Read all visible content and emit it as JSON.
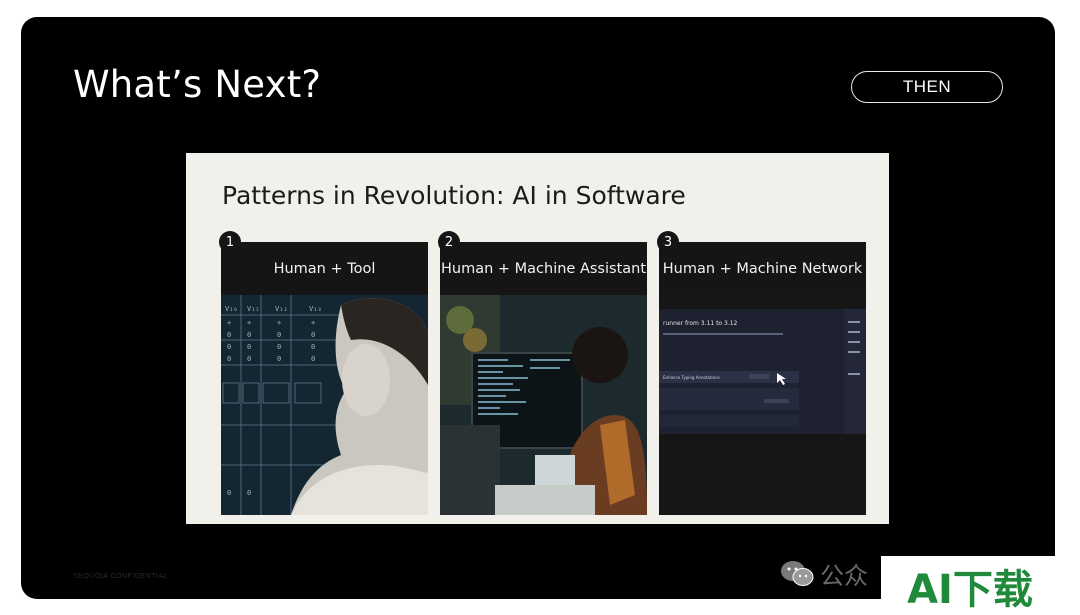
{
  "slide": {
    "title": "What’s Next?",
    "tag": "THEN",
    "footer": "SEQUOIA CONFIDENTIAL"
  },
  "inner": {
    "title": "Patterns in Revolution: AI in Software",
    "cards": [
      {
        "number": "1",
        "label": "Human + Tool"
      },
      {
        "number": "2",
        "label": "Human + Machine Assistant"
      },
      {
        "number": "3",
        "label": "Human + Machine Network"
      }
    ],
    "card3_screen": {
      "heading": "runner from 3.11 to 3.12",
      "row": "Enhance Typing Annotations"
    }
  },
  "overlay": {
    "wechat_text": "公众",
    "watermark": "AI下载"
  },
  "colors": {
    "slide_bg": "#000000",
    "panel_bg": "#f1f0ea",
    "card_bg": "#151515",
    "watermark": "#1f8a3a"
  }
}
